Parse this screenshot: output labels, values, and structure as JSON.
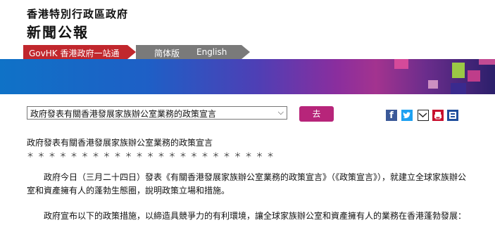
{
  "masthead": {
    "line1": "香港特別行政區政府",
    "line2": "新聞公報"
  },
  "nav": {
    "govhk": "GovHK 香港政府一站通",
    "simplified": "简体版",
    "english": "English"
  },
  "headline_select": {
    "selected": "政府發表有關香港發展家族辦公室業務的政策宣言",
    "go_label": "去"
  },
  "share_icons": [
    "facebook-icon",
    "twitter-icon",
    "mail-icon",
    "print-icon",
    "zoom-icon"
  ],
  "content": {
    "title": "政府發表有關香港發展家族辦公室業務的政策宣言",
    "stars": "＊＊＊＊＊＊＊＊＊＊＊＊＊＊＊＊＊＊＊＊＊＊＊",
    "para1": "政府今日（三月二十四日）發表《有關香港發展家族辦公室業務的政策宣言》（《政策宣言》），就建立全球家族辦公室和資產擁有人的蓬勃生態圈，說明政策立場和措施。",
    "para2": "政府宣布以下的政策措施，以締造具競爭力的有利環境，讓全球家族辦公室和資產擁有人的業務在香港蓬勃發展："
  },
  "colors": {
    "nav_red": "#c1272d",
    "nav_gray": "#7a7a7a",
    "go_button": "#b7257a"
  }
}
